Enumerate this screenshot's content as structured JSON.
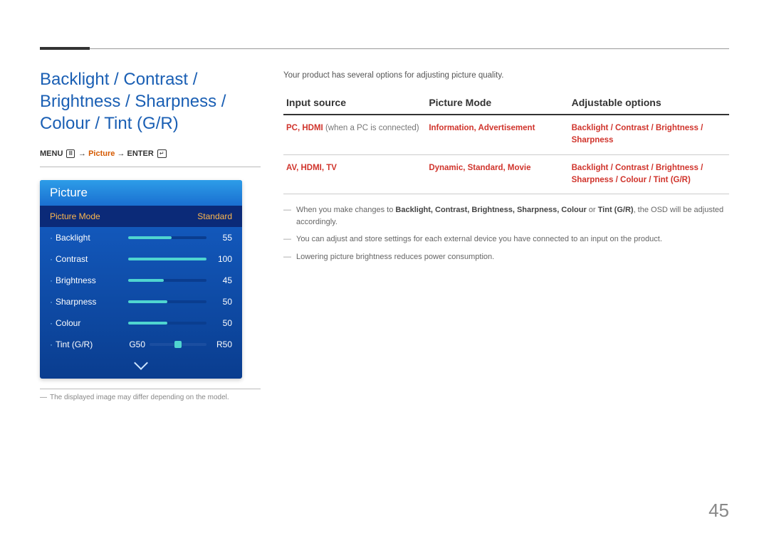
{
  "section_title": "Backlight / Contrast / Brightness / Sharpness / Colour / Tint (G/R)",
  "breadcrumb": {
    "menu": "MENU",
    "picture": "Picture",
    "enter": "ENTER",
    "arrow": " → "
  },
  "osd": {
    "header": "Picture",
    "mode_row": {
      "label": "Picture Mode",
      "value": "Standard"
    },
    "rows": [
      {
        "label": "Backlight",
        "value": "55",
        "pct": 55
      },
      {
        "label": "Contrast",
        "value": "100",
        "pct": 100
      },
      {
        "label": "Brightness",
        "value": "45",
        "pct": 45
      },
      {
        "label": "Sharpness",
        "value": "50",
        "pct": 50
      },
      {
        "label": "Colour",
        "value": "50",
        "pct": 50
      }
    ],
    "tint": {
      "label": "Tint (G/R)",
      "g": "G50",
      "r": "R50",
      "pos": 50
    }
  },
  "footnote": "The displayed image may differ depending on the model.",
  "intro": "Your product has several options for adjusting picture quality.",
  "table": {
    "headers": {
      "c1": "Input source",
      "c2": "Picture Mode",
      "c3": "Adjustable options"
    },
    "rows": [
      {
        "c1_red": "PC, HDMI",
        "c1_gray": " (when a PC is connected)",
        "c2": "Information, Advertisement",
        "c3": "Backlight / Contrast / Brightness / Sharpness"
      },
      {
        "c1_red": "AV, HDMI, TV",
        "c1_gray": "",
        "c2": "Dynamic, Standard, Movie",
        "c3": "Backlight / Contrast / Brightness / Sharpness / Colour / Tint (G/R)"
      }
    ]
  },
  "notes": {
    "n1_pre": "When you make changes to ",
    "n1_terms": "Backlight, Contrast, Brightness, Sharpness, Colour",
    "n1_or": " or ",
    "n1_tint": "Tint (G/R)",
    "n1_post": ", the OSD will be adjusted accordingly.",
    "n2": "You can adjust and store settings for each external device you have connected to an input on the product.",
    "n3": "Lowering picture brightness reduces power consumption."
  },
  "page_number": "45"
}
